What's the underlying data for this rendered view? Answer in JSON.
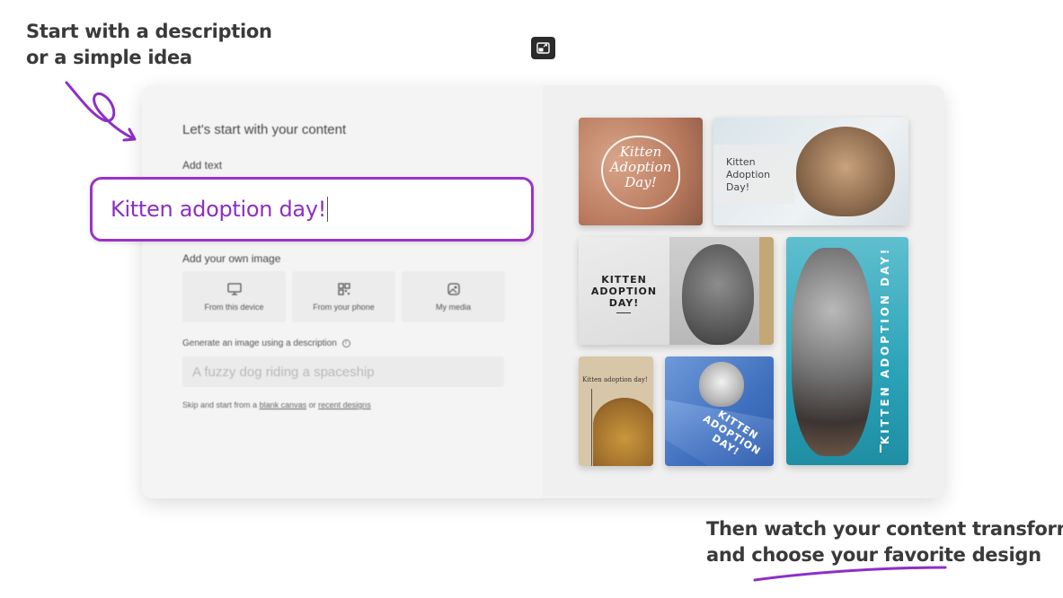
{
  "captions": {
    "top_line1": "Start with a description",
    "top_line2": "or a simple idea",
    "bottom_line1": "Then watch your content transform",
    "bottom_line2": "and choose your favorite design"
  },
  "form": {
    "title": "Let's start with your content",
    "add_text_label": "Add text",
    "text_value": "Kitten adoption day!",
    "add_image_label": "Add your own image",
    "upload_options": [
      {
        "label": "From this device",
        "icon": "monitor-icon"
      },
      {
        "label": "From your phone",
        "icon": "qr-code-icon"
      },
      {
        "label": "My media",
        "icon": "image-icon"
      }
    ],
    "generate_label": "Generate an image using a description",
    "generate_placeholder": "A fuzzy dog riding a spaceship",
    "skip_prefix": "Skip and start from a",
    "skip_link1": "blank canvas",
    "skip_mid": "or",
    "skip_link2": "recent designs"
  },
  "designs": {
    "d1_line1": "Kitten",
    "d1_line2": "Adoption",
    "d1_line3": "Day!",
    "d2_line1": "Kitten",
    "d2_line2": "Adoption",
    "d2_line3": "Day!",
    "d3_line1": "KITTEN",
    "d3_line2": "ADOPTION",
    "d3_line3": "DAY!",
    "d4_text": "KITTEN ADOPTION DAY!",
    "d5_text": "Kitten adoption day!",
    "d6_line1": "KITTEN",
    "d6_line2": "ADOPTION",
    "d6_line3": "DAY!"
  },
  "colors": {
    "accent": "#9b34c7",
    "caption": "#3a3a3a"
  }
}
